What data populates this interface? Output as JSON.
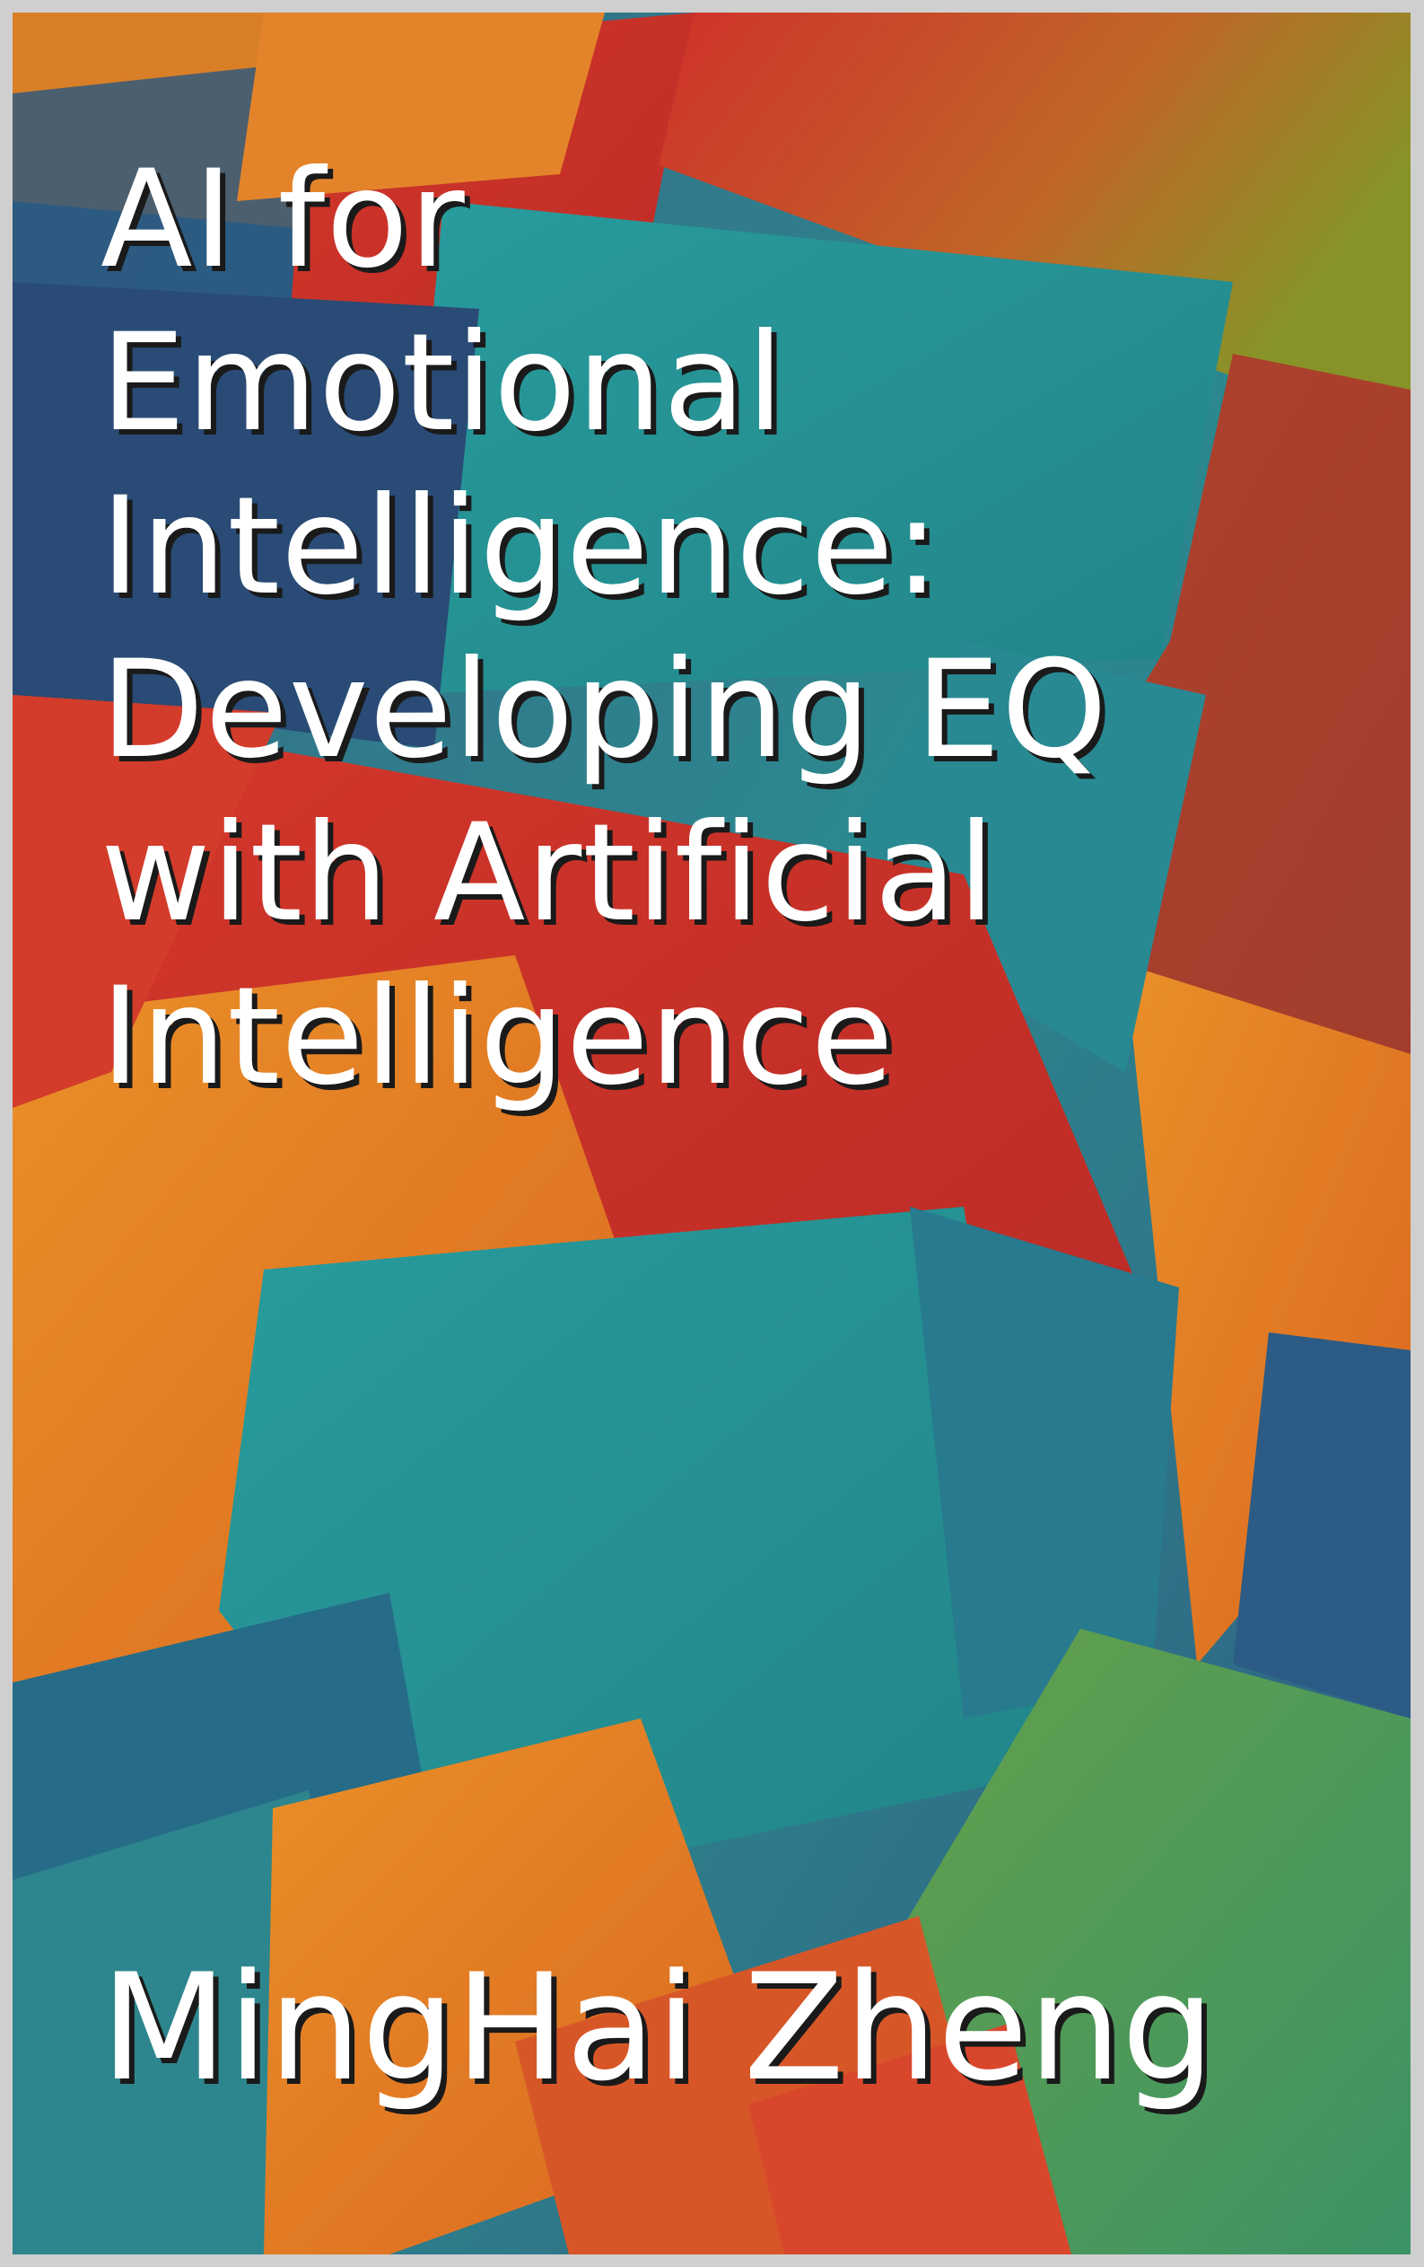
{
  "book": {
    "title_lines": [
      "AI for",
      "Emotional",
      "Intelligence:",
      "Developing EQ",
      "with Artificial",
      "Intelligence"
    ],
    "author": "MingHai Zheng"
  },
  "palette": {
    "orange": "#ef8a25",
    "red": "#d8382c",
    "teal": "#2fa3a2",
    "blue": "#2a6f9a",
    "green": "#6ea34a"
  }
}
